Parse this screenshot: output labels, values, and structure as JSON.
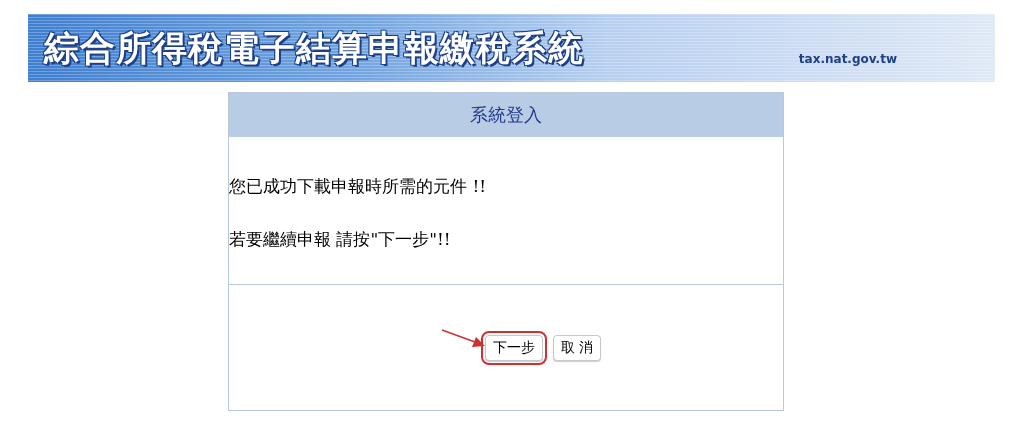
{
  "banner": {
    "title": "綜合所得稅電子結算申報繳稅系統",
    "site": "tax.nat.gov.tw"
  },
  "panel": {
    "title": "系統登入",
    "messages": [
      "您已成功下載申報時所需的元件 !!",
      "若要繼續申報 請按\"下一步\"!!"
    ],
    "buttons": [
      {
        "label": "下一步",
        "highlighted": true
      },
      {
        "label": "取 消",
        "highlighted": false
      }
    ]
  }
}
